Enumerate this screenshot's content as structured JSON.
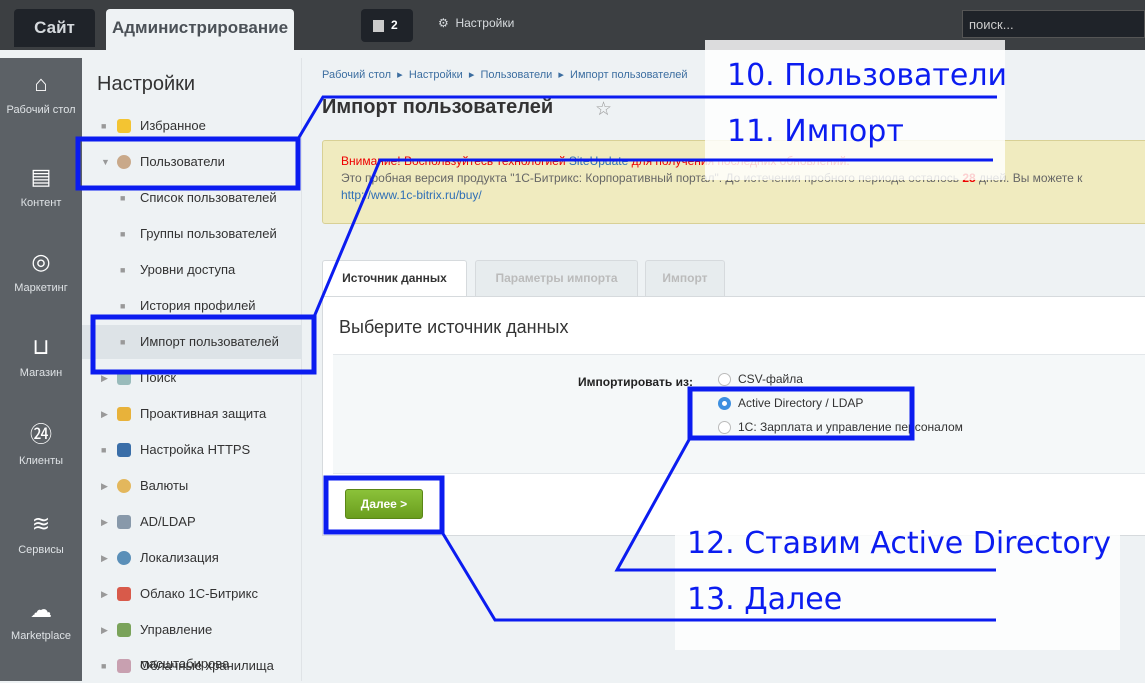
{
  "topbar": {
    "site_tab": "Сайт",
    "admin_tab": "Администрирование",
    "notifications_count": "2",
    "settings_label": "Настройки",
    "search_placeholder": "поиск..."
  },
  "iconbar": [
    {
      "label": "Рабочий стол",
      "icon": "home-icon"
    },
    {
      "label": "Контент",
      "icon": "document-icon"
    },
    {
      "label": "Маркетинг",
      "icon": "target-icon"
    },
    {
      "label": "Магазин",
      "icon": "basket-icon"
    },
    {
      "label": "Клиенты",
      "icon": "clients-24-icon"
    },
    {
      "label": "Сервисы",
      "icon": "layers-icon"
    },
    {
      "label": "Marketplace",
      "icon": "cloud-download-icon"
    }
  ],
  "sidebar": {
    "title": "Настройки",
    "items": [
      {
        "label": "Избранное",
        "icon": "star-icon"
      },
      {
        "label": "Пользователи",
        "icon": "user-icon"
      },
      {
        "label": "Список пользователей"
      },
      {
        "label": "Группы пользователей"
      },
      {
        "label": "Уровни доступа"
      },
      {
        "label": "История профилей"
      },
      {
        "label": "Импорт пользователей"
      },
      {
        "label": "Поиск",
        "icon": "search-icon"
      },
      {
        "label": "Проактивная защита",
        "icon": "lock-icon"
      },
      {
        "label": "Настройка HTTPS",
        "icon": "lock-icon"
      },
      {
        "label": "Валюты",
        "icon": "currency-icon"
      },
      {
        "label": "AD/LDAP",
        "icon": "ldap-icon"
      },
      {
        "label": "Локализация",
        "icon": "globe-icon"
      },
      {
        "label": "Облако 1С-Битрикс",
        "icon": "cloud-icon"
      },
      {
        "label": "Управление масштабирова",
        "icon": "scale-icon"
      },
      {
        "label": "Облачные хранилища",
        "icon": "storage-icon"
      }
    ]
  },
  "breadcrumb": [
    "Рабочий стол",
    "Настройки",
    "Пользователи",
    "Импорт пользователей"
  ],
  "page_title": "Импорт пользователей",
  "warning": {
    "prefix": "Внимание!",
    "text1": " Воспользуйтесь технологией ",
    "link": "SiteUpdate",
    "text2": " для получения последних обновлений.",
    "line2a": "Это пробная версия продукта \"1С-Битрикс: Корпоративный портал\". До истечения пробного периода осталось ",
    "days": "28",
    "line2b": " дней. Вы можете к",
    "buy_link": "http://www.1c-bitrix.ru/buy/"
  },
  "tabs": [
    "Источник данных",
    "Параметры импорта",
    "Импорт"
  ],
  "panel": {
    "title": "Выберите источник данных",
    "import_from_label": "Импортировать из:",
    "options": [
      "CSV-файла",
      "Active Directory / LDAP",
      "1С: Зарплата и управление персоналом"
    ],
    "selected": "Active Directory / LDAP",
    "next_button": "Далее >"
  },
  "annotations": [
    "10. Пользователи",
    "11. Импорт",
    "12. Ставим Active Directory",
    "13. Далее"
  ],
  "colors": {
    "annotation": "#0b1cf0",
    "accent_button": "#76ab26"
  }
}
